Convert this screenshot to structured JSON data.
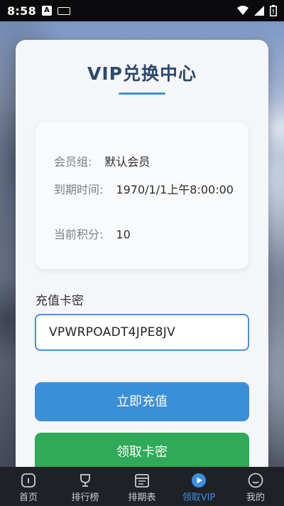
{
  "status_bar": {
    "time": "8:58",
    "notification_badge": "A"
  },
  "card": {
    "title": "VIP兑换中心",
    "info": {
      "group_label": "会员组:",
      "group_value": "默认会员",
      "expire_label": "到期时间:",
      "expire_value": "1970/1/1上午8:00:00",
      "points_label": "当前积分:",
      "points_value": "10"
    },
    "card_key_label": "充值卡密",
    "card_key_value": "VPWRPOADT4JPE8JV",
    "recharge_button": "立即充值",
    "get_key_button": "领取卡密"
  },
  "bottom_nav": {
    "items": [
      {
        "label": "首页",
        "icon": "home-icon",
        "active": false
      },
      {
        "label": "排行榜",
        "icon": "trophy-icon",
        "active": false
      },
      {
        "label": "排期表",
        "icon": "calendar-icon",
        "active": false
      },
      {
        "label": "领取VIP",
        "icon": "play-circle-icon",
        "active": true
      },
      {
        "label": "我的",
        "icon": "smile-icon",
        "active": false
      }
    ]
  },
  "colors": {
    "accent": "#3a8fd9",
    "success": "#2eaa58",
    "title": "#2d4a6b",
    "nav_active": "#3a8fe6"
  }
}
